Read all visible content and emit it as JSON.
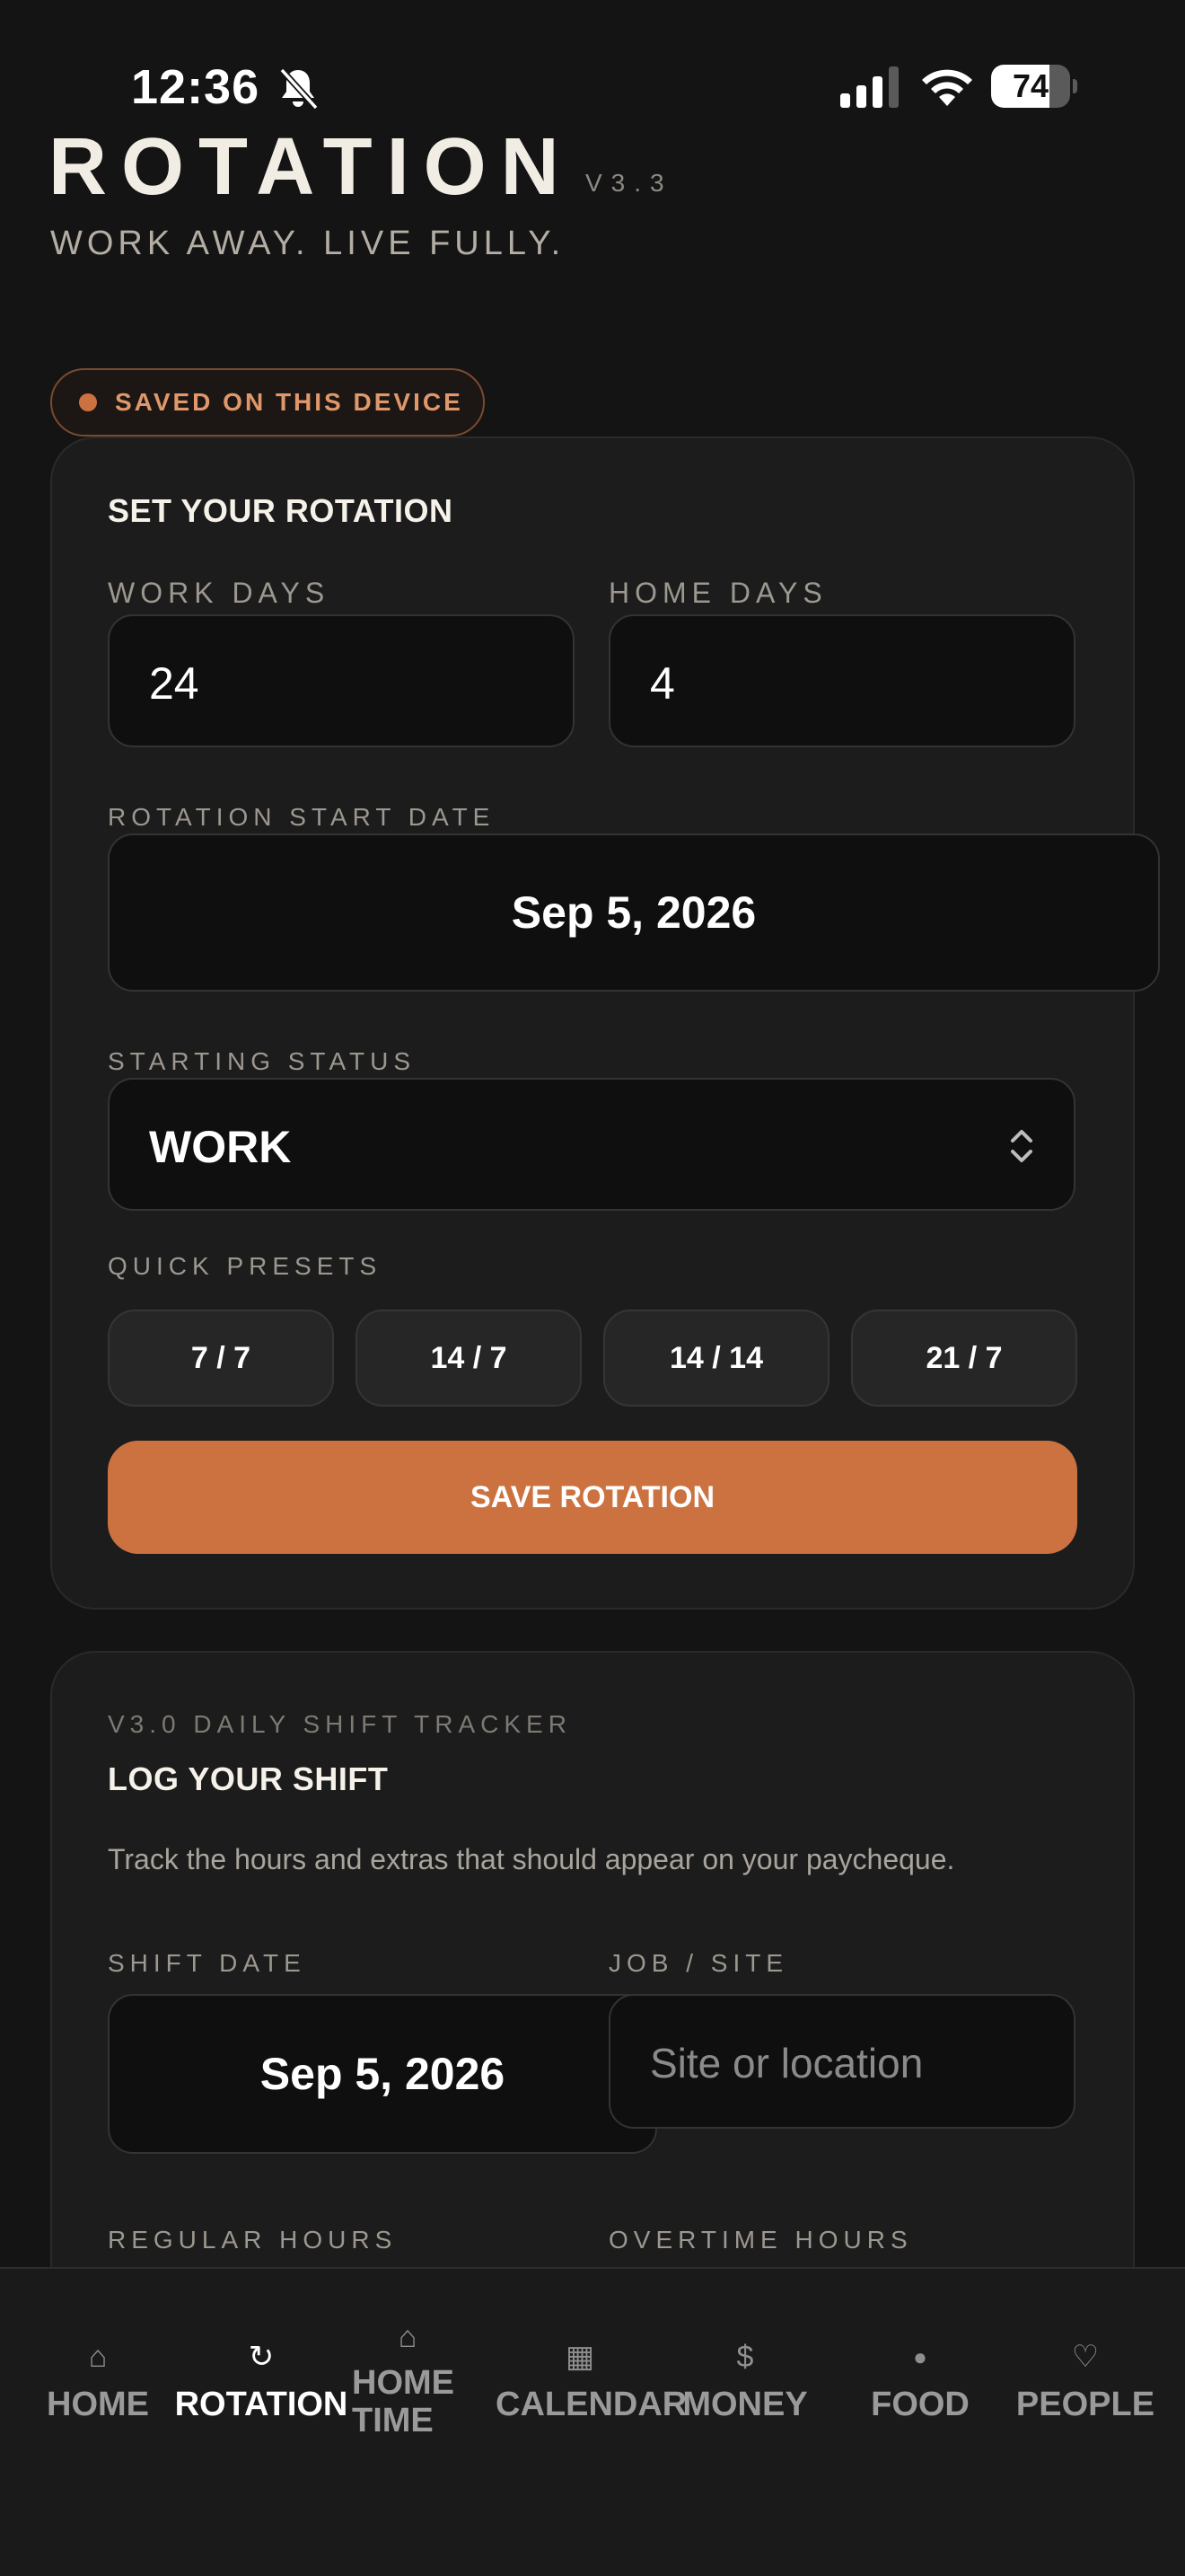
{
  "status_bar": {
    "time": "12:36",
    "battery": "74",
    "battery_level": 0.74
  },
  "header": {
    "brand": "ROTATION",
    "version": "V3.3",
    "tagline": "WORK AWAY. LIVE FULLY."
  },
  "saved_badge": "SAVED ON THIS DEVICE",
  "rotation_card": {
    "title": "SET YOUR ROTATION",
    "work_days_label": "WORK DAYS",
    "work_days_value": "24",
    "home_days_label": "HOME DAYS",
    "home_days_value": "4",
    "start_date_label": "ROTATION START DATE",
    "start_date_value": "Sep 5, 2026",
    "starting_status_label": "STARTING STATUS",
    "starting_status_value": "WORK",
    "quick_presets_label": "QUICK PRESETS",
    "presets": [
      "7 / 7",
      "14 / 7",
      "14 / 14",
      "21 / 7"
    ],
    "save_button": "SAVE ROTATION"
  },
  "shift_card": {
    "eyebrow": "V3.0 DAILY SHIFT TRACKER",
    "title": "LOG YOUR SHIFT",
    "description": "Track the hours and extras that should appear on your paycheque.",
    "shift_date_label": "SHIFT DATE",
    "shift_date_value": "Sep 5, 2026",
    "job_site_label": "JOB / SITE",
    "job_site_placeholder": "Site or location",
    "regular_hours_label": "REGULAR HOURS",
    "overtime_hours_label": "OVERTIME HOURS"
  },
  "tabbar": {
    "items": [
      {
        "icon": "⌂",
        "icon_name": "home-icon",
        "label": "HOME"
      },
      {
        "icon": "↻",
        "icon_name": "rotation-icon",
        "label": "ROTATION"
      },
      {
        "icon": "⌂",
        "icon_name": "home-time-icon",
        "label": "HOME TIME"
      },
      {
        "icon": "▦",
        "icon_name": "calendar-icon",
        "label": "CALENDAR"
      },
      {
        "icon": "$",
        "icon_name": "money-icon",
        "label": "MONEY"
      },
      {
        "icon": "●",
        "icon_name": "food-icon",
        "label": "FOOD"
      },
      {
        "icon": "♡",
        "icon_name": "people-icon",
        "label": "PEOPLE"
      }
    ],
    "active": "ROTATION"
  },
  "colors": {
    "background": "#141414",
    "card": "#1c1c1c",
    "accent": "#cc7240",
    "text": "#f2ede4"
  }
}
